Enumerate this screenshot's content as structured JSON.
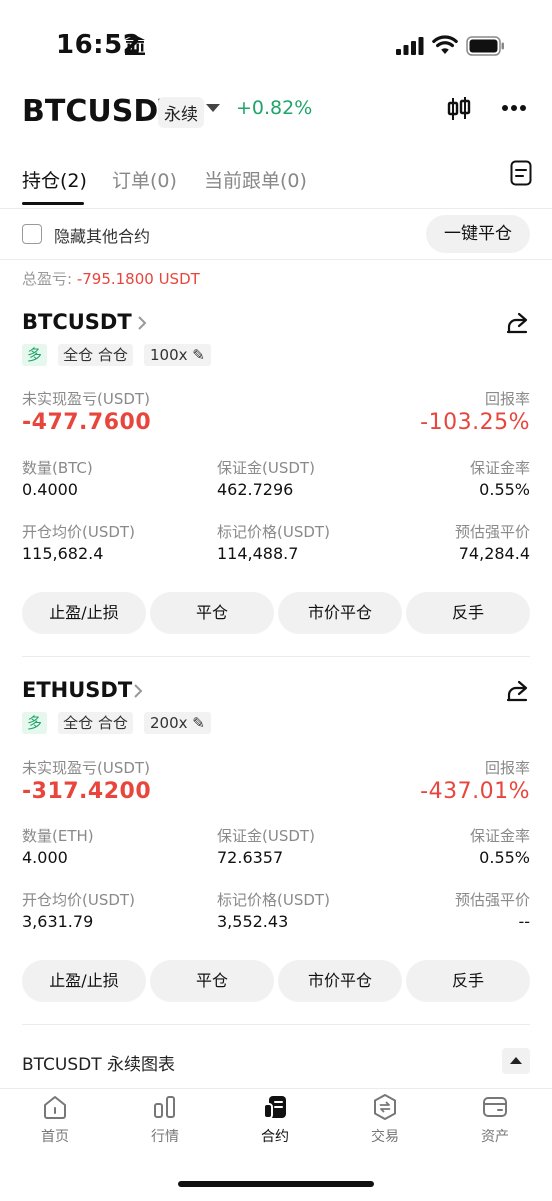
{
  "status": {
    "time": "16:52"
  },
  "header": {
    "symbol": "BTCUSDT",
    "type": "永续",
    "change": "+0.82%"
  },
  "tabs": [
    {
      "label": "持仓(2)",
      "active": true
    },
    {
      "label": "订单(0)",
      "active": false
    },
    {
      "label": "当前跟单(0)",
      "active": false
    }
  ],
  "filter": {
    "hide_label": "隐藏其他合约",
    "close_all": "一键平仓"
  },
  "total": {
    "label": "总盈亏: ",
    "value": "-795.1800 USDT"
  },
  "positions": [
    {
      "name": "BTCUSDT",
      "side": "多",
      "mode": "全仓 合仓",
      "leverage": "100x",
      "pnl_label": "未实现盈亏(USDT)",
      "pnl": "-477.7600",
      "roe_label": "回报率",
      "roe": "-103.25%",
      "qty_label": "数量(BTC)",
      "qty": "0.4000",
      "margin_label": "保证金(USDT)",
      "margin": "462.7296",
      "margin_ratio_label": "保证金率",
      "margin_ratio": "0.55%",
      "entry_label": "开仓均价(USDT)",
      "entry": "115,682.4",
      "mark_label": "标记价格(USDT)",
      "mark": "114,488.7",
      "liq_label": "预估强平价",
      "liq": "74,284.4",
      "buttons": [
        "止盈/止损",
        "平仓",
        "市价平仓",
        "反手"
      ]
    },
    {
      "name": "ETHUSDT",
      "side": "多",
      "mode": "全仓 合仓",
      "leverage": "200x",
      "pnl_label": "未实现盈亏(USDT)",
      "pnl": "-317.4200",
      "roe_label": "回报率",
      "roe": "-437.01%",
      "qty_label": "数量(ETH)",
      "qty": "4.000",
      "margin_label": "保证金(USDT)",
      "margin": "72.6357",
      "margin_ratio_label": "保证金率",
      "margin_ratio": "0.55%",
      "entry_label": "开仓均价(USDT)",
      "entry": "3,631.79",
      "mark_label": "标记价格(USDT)",
      "mark": "3,552.43",
      "liq_label": "预估强平价",
      "liq": "--",
      "buttons": [
        "止盈/止损",
        "平仓",
        "市价平仓",
        "反手"
      ]
    }
  ],
  "chart_bar": {
    "label": "BTCUSDT 永续图表"
  },
  "nav": [
    {
      "label": "首页",
      "icon": "home-icon"
    },
    {
      "label": "行情",
      "icon": "market-icon"
    },
    {
      "label": "合约",
      "icon": "futures-icon",
      "active": true
    },
    {
      "label": "交易",
      "icon": "trade-icon"
    },
    {
      "label": "资产",
      "icon": "wallet-icon"
    }
  ],
  "colors": {
    "up": "#1fa56a",
    "down": "#e8453c"
  }
}
